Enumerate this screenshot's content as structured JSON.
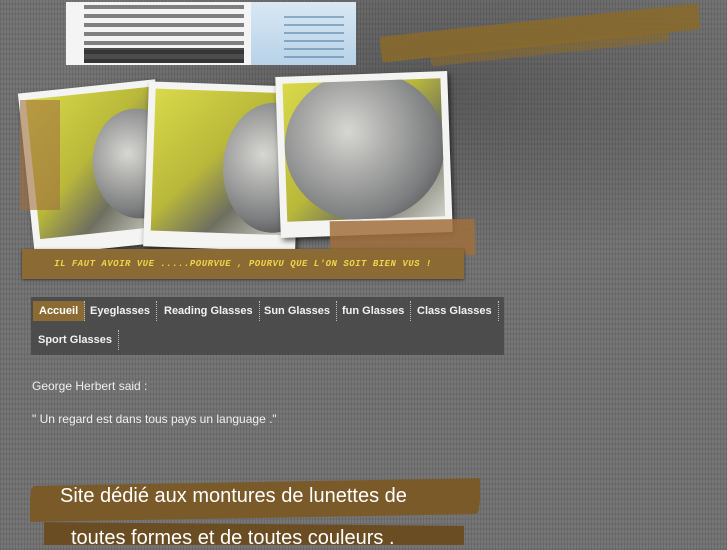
{
  "logo": {
    "icon": "eye-chart-logo"
  },
  "motto": "IL FAUT AVOIR VUE .....POURVUE , POURVU QUE L'ON SOIT BIEN VUS !",
  "nav": {
    "items": [
      {
        "label": "Accueil",
        "active": true
      },
      {
        "label": "Eyeglasses"
      },
      {
        "label": "Reading Glasses"
      },
      {
        "label": "Sun Glasses"
      },
      {
        "label": "fun Glasses"
      },
      {
        "label": "Class Glasses"
      },
      {
        "label": "Sport Glasses"
      }
    ]
  },
  "quote": {
    "author": "George Herbert said  :",
    "text": "\" Un regard est dans tous pays un language .\""
  },
  "banner": {
    "line1": "Site dédié aux montures de lunettes de",
    "line2": "toutes formes et de toutes couleurs ."
  },
  "colors": {
    "accent": "#8b6a34",
    "motto": "#f0d54a",
    "nav_bg": "#464646",
    "background": "#6f6f6f"
  }
}
